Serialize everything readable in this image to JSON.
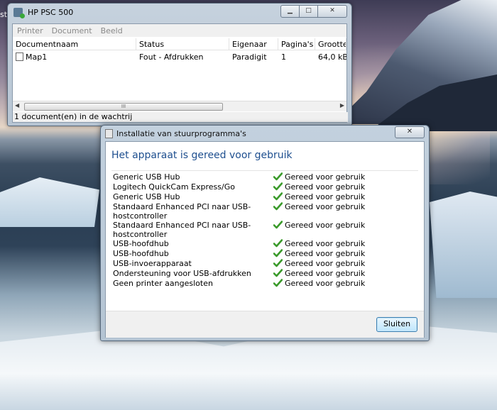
{
  "desktop": {
    "left_fragment": "st"
  },
  "print_queue": {
    "title": "HP PSC 500",
    "caption_buttons": {
      "minimize": "▁",
      "maximize": "□",
      "close": "✕"
    },
    "menu": [
      "Printer",
      "Document",
      "Beeld"
    ],
    "columns": [
      "Documentnaam",
      "Status",
      "Eigenaar",
      "Pagina's",
      "Grootte"
    ],
    "rows": [
      {
        "name": "Map1",
        "status": "Fout - Afdrukken",
        "owner": "Paradigit",
        "pages": "1",
        "size": "64,0 kB"
      }
    ],
    "scroll_thumb_grip": "III",
    "status_text": "1 document(en) in de wachtrij"
  },
  "driver_dialog": {
    "title": "Installatie van stuurprogramma's",
    "close_glyph": "✕",
    "heading": "Het apparaat is gereed voor gebruik",
    "devices": [
      {
        "name": "Generic USB Hub",
        "status": "Gereed voor gebruik"
      },
      {
        "name": "Logitech QuickCam Express/Go",
        "status": "Gereed voor gebruik"
      },
      {
        "name": "Generic USB Hub",
        "status": "Gereed voor gebruik"
      },
      {
        "name": "Standaard Enhanced PCI naar USB-hostcontroller",
        "status": "Gereed voor gebruik"
      },
      {
        "name": "Standaard Enhanced PCI naar USB-hostcontroller",
        "status": "Gereed voor gebruik"
      },
      {
        "name": "USB-hoofdhub",
        "status": "Gereed voor gebruik"
      },
      {
        "name": "USB-hoofdhub",
        "status": "Gereed voor gebruik"
      },
      {
        "name": "USB-invoerapparaat",
        "status": "Gereed voor gebruik"
      },
      {
        "name": "Ondersteuning voor USB-afdrukken",
        "status": "Gereed voor gebruik"
      },
      {
        "name": "Geen printer aangesloten",
        "status": "Gereed voor gebruik"
      }
    ],
    "button_label": "Sluiten",
    "check_color": "#3a9a2a"
  }
}
